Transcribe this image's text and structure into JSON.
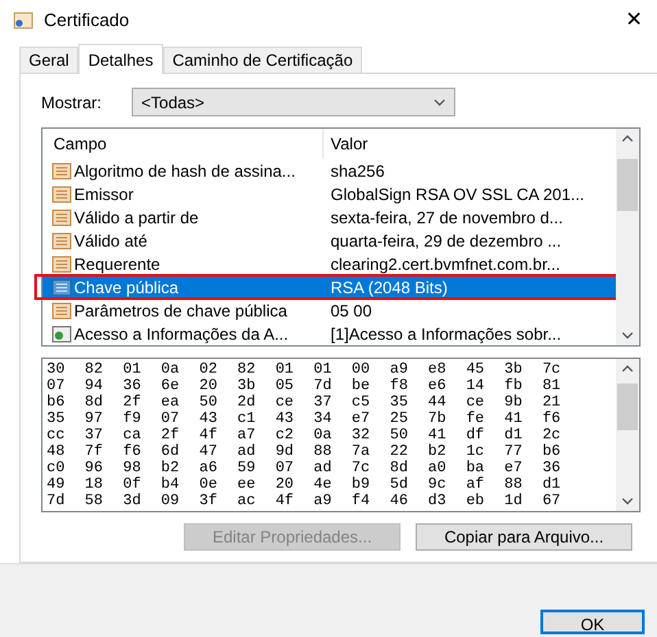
{
  "window": {
    "title": "Certificado",
    "close": "✕"
  },
  "tabs": [
    {
      "label": "Geral",
      "selected": false
    },
    {
      "label": "Detalhes",
      "selected": true
    },
    {
      "label": "Caminho de Certificação",
      "selected": false
    }
  ],
  "show": {
    "label": "Mostrar:",
    "value": "<Todas>"
  },
  "table": {
    "columns": [
      "Campo",
      "Valor"
    ],
    "rows": [
      {
        "kind": "field",
        "field": "Algoritmo de hash de assina...",
        "value": "sha256",
        "selected": false,
        "highlighted": false
      },
      {
        "kind": "field",
        "field": "Emissor",
        "value": "GlobalSign RSA OV SSL CA 201...",
        "selected": false,
        "highlighted": false
      },
      {
        "kind": "field",
        "field": "Válido a partir de",
        "value": "sexta-feira, 27 de novembro d...",
        "selected": false,
        "highlighted": false
      },
      {
        "kind": "field",
        "field": "Válido até",
        "value": "quarta-feira, 29 de dezembro ...",
        "selected": false,
        "highlighted": false
      },
      {
        "kind": "field",
        "field": "Requerente",
        "value": "clearing2.cert.bvmfnet.com.br...",
        "selected": false,
        "highlighted": false
      },
      {
        "kind": "field",
        "field": "Chave pública",
        "value": "RSA (2048 Bits)",
        "selected": true,
        "highlighted": true
      },
      {
        "kind": "field",
        "field": "Parâmetros de chave pública",
        "value": "05 00",
        "selected": false,
        "highlighted": false
      },
      {
        "kind": "extension",
        "field": "Acesso a Informações da A...",
        "value": "[1]Acesso a Informações sobr...",
        "selected": false,
        "highlighted": false
      }
    ]
  },
  "hex_lines": [
    "30 82 01 0a 02 82 01 01 00 a9 e8 45 3b 7c",
    "07 94 36 6e 20 3b 05 7d be f8 e6 14 fb 81",
    "b6 8d 2f ea 50 2d ce 37 c5 35 44 ce 9b 21",
    "35 97 f9 07 43 c1 43 34 e7 25 7b fe 41 f6",
    "cc 37 ca 2f 4f a7 c2 0a 32 50 41 df d1 2c",
    "48 7f f6 6d 47 ad 9d 88 7a 22 b2 1c 77 b6",
    "c0 96 98 b2 a6 59 07 ad 7c 8d a0 ba e7 36",
    "49 18 0f b4 0e ee 20 4e b9 5d 9c af 88 d1",
    "7d 58 3d 09 3f ac 4f a9 f4 46 d3 eb 1d 67"
  ],
  "buttons": [
    {
      "label": "Editar Propriedades...",
      "disabled": true
    },
    {
      "label": "Copiar para Arquivo...",
      "disabled": false
    }
  ],
  "ok": "OK"
}
